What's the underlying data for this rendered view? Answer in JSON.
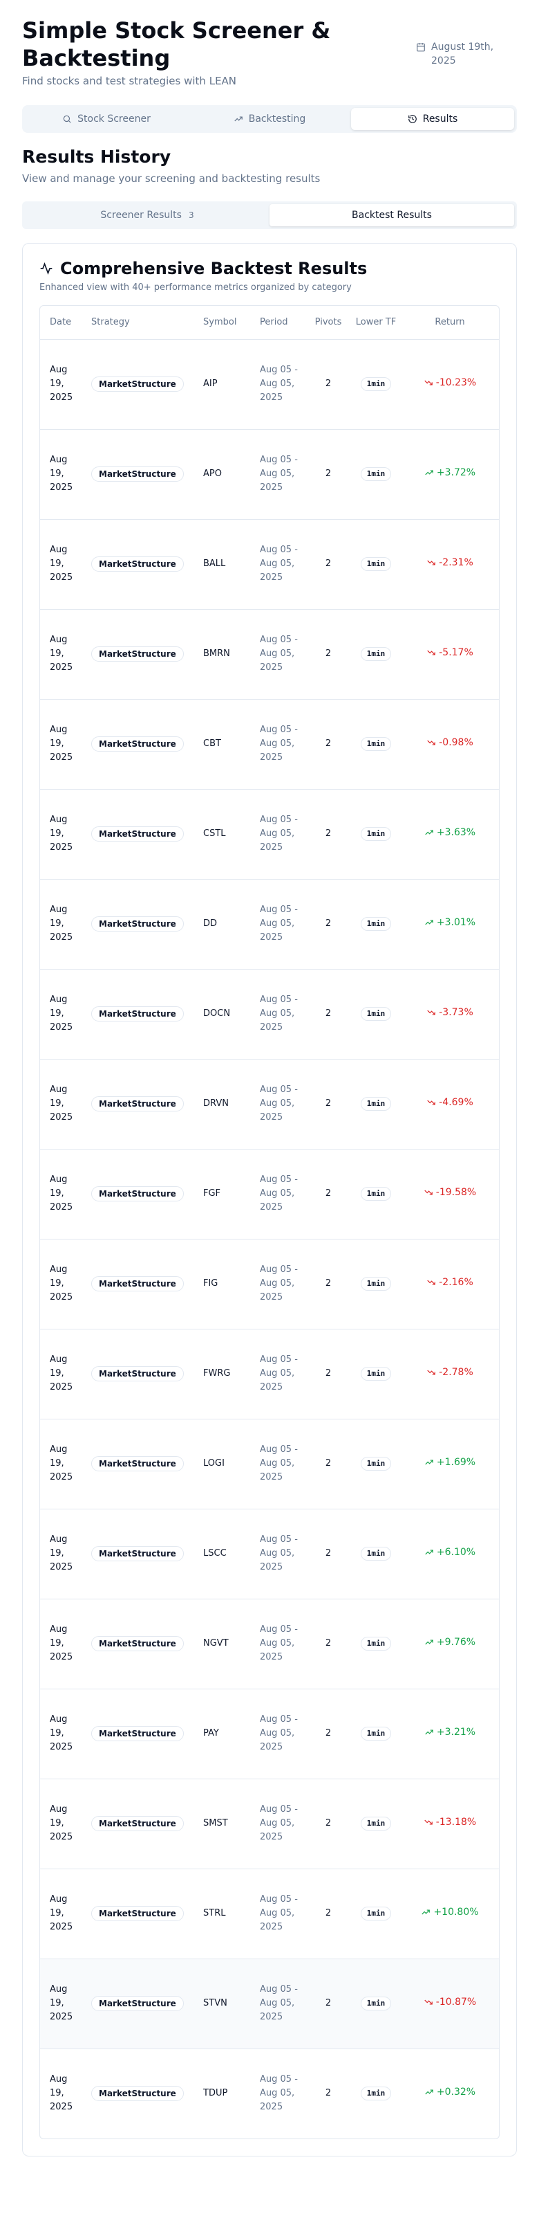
{
  "app": {
    "title": "Simple Stock Screener & Backtesting",
    "subtitle": "Find stocks and test strategies with LEAN",
    "date": "August 19th, 2025"
  },
  "main_tabs": [
    {
      "label": "Stock Screener",
      "icon": "search-icon",
      "active": false
    },
    {
      "label": "Backtesting",
      "icon": "trending-up-icon",
      "active": false
    },
    {
      "label": "Results",
      "icon": "history-icon",
      "active": true
    }
  ],
  "section": {
    "title": "Results History",
    "subtitle": "View and manage your screening and backtesting results"
  },
  "sub_tabs": [
    {
      "label": "Screener Results",
      "count": "3",
      "active": false
    },
    {
      "label": "Backtest Results",
      "count": "",
      "active": true
    }
  ],
  "card": {
    "title": "Comprehensive Backtest Results",
    "subtitle": "Enhanced view with 40+ performance metrics organized by category"
  },
  "table": {
    "headers": {
      "date": "Date",
      "strategy": "Strategy",
      "symbol": "Symbol",
      "period": "Period",
      "pivots": "Pivots",
      "lower_tf": "Lower TF",
      "return": "Return"
    },
    "rows": [
      {
        "date": "Aug 19, 2025",
        "strategy": "MarketStructure",
        "symbol": "AIP",
        "period": "Aug 05 - Aug 05, 2025",
        "pivots": "2",
        "tf": "1min",
        "ret": "-10.23%",
        "dir": "neg"
      },
      {
        "date": "Aug 19, 2025",
        "strategy": "MarketStructure",
        "symbol": "APO",
        "period": "Aug 05 - Aug 05, 2025",
        "pivots": "2",
        "tf": "1min",
        "ret": "+3.72%",
        "dir": "pos"
      },
      {
        "date": "Aug 19, 2025",
        "strategy": "MarketStructure",
        "symbol": "BALL",
        "period": "Aug 05 - Aug 05, 2025",
        "pivots": "2",
        "tf": "1min",
        "ret": "-2.31%",
        "dir": "neg"
      },
      {
        "date": "Aug 19, 2025",
        "strategy": "MarketStructure",
        "symbol": "BMRN",
        "period": "Aug 05 - Aug 05, 2025",
        "pivots": "2",
        "tf": "1min",
        "ret": "-5.17%",
        "dir": "neg"
      },
      {
        "date": "Aug 19, 2025",
        "strategy": "MarketStructure",
        "symbol": "CBT",
        "period": "Aug 05 - Aug 05, 2025",
        "pivots": "2",
        "tf": "1min",
        "ret": "-0.98%",
        "dir": "neg"
      },
      {
        "date": "Aug 19, 2025",
        "strategy": "MarketStructure",
        "symbol": "CSTL",
        "period": "Aug 05 - Aug 05, 2025",
        "pivots": "2",
        "tf": "1min",
        "ret": "+3.63%",
        "dir": "pos"
      },
      {
        "date": "Aug 19, 2025",
        "strategy": "MarketStructure",
        "symbol": "DD",
        "period": "Aug 05 - Aug 05, 2025",
        "pivots": "2",
        "tf": "1min",
        "ret": "+3.01%",
        "dir": "pos"
      },
      {
        "date": "Aug 19, 2025",
        "strategy": "MarketStructure",
        "symbol": "DOCN",
        "period": "Aug 05 - Aug 05, 2025",
        "pivots": "2",
        "tf": "1min",
        "ret": "-3.73%",
        "dir": "neg"
      },
      {
        "date": "Aug 19, 2025",
        "strategy": "MarketStructure",
        "symbol": "DRVN",
        "period": "Aug 05 - Aug 05, 2025",
        "pivots": "2",
        "tf": "1min",
        "ret": "-4.69%",
        "dir": "neg"
      },
      {
        "date": "Aug 19, 2025",
        "strategy": "MarketStructure",
        "symbol": "FGF",
        "period": "Aug 05 - Aug 05, 2025",
        "pivots": "2",
        "tf": "1min",
        "ret": "-19.58%",
        "dir": "neg"
      },
      {
        "date": "Aug 19, 2025",
        "strategy": "MarketStructure",
        "symbol": "FIG",
        "period": "Aug 05 - Aug 05, 2025",
        "pivots": "2",
        "tf": "1min",
        "ret": "-2.16%",
        "dir": "neg"
      },
      {
        "date": "Aug 19, 2025",
        "strategy": "MarketStructure",
        "symbol": "FWRG",
        "period": "Aug 05 - Aug 05, 2025",
        "pivots": "2",
        "tf": "1min",
        "ret": "-2.78%",
        "dir": "neg"
      },
      {
        "date": "Aug 19, 2025",
        "strategy": "MarketStructure",
        "symbol": "LOGI",
        "period": "Aug 05 - Aug 05, 2025",
        "pivots": "2",
        "tf": "1min",
        "ret": "+1.69%",
        "dir": "pos"
      },
      {
        "date": "Aug 19, 2025",
        "strategy": "MarketStructure",
        "symbol": "LSCC",
        "period": "Aug 05 - Aug 05, 2025",
        "pivots": "2",
        "tf": "1min",
        "ret": "+6.10%",
        "dir": "pos"
      },
      {
        "date": "Aug 19, 2025",
        "strategy": "MarketStructure",
        "symbol": "NGVT",
        "period": "Aug 05 - Aug 05, 2025",
        "pivots": "2",
        "tf": "1min",
        "ret": "+9.76%",
        "dir": "pos"
      },
      {
        "date": "Aug 19, 2025",
        "strategy": "MarketStructure",
        "symbol": "PAY",
        "period": "Aug 05 - Aug 05, 2025",
        "pivots": "2",
        "tf": "1min",
        "ret": "+3.21%",
        "dir": "pos"
      },
      {
        "date": "Aug 19, 2025",
        "strategy": "MarketStructure",
        "symbol": "SMST",
        "period": "Aug 05 - Aug 05, 2025",
        "pivots": "2",
        "tf": "1min",
        "ret": "-13.18%",
        "dir": "neg"
      },
      {
        "date": "Aug 19, 2025",
        "strategy": "MarketStructure",
        "symbol": "STRL",
        "period": "Aug 05 - Aug 05, 2025",
        "pivots": "2",
        "tf": "1min",
        "ret": "+10.80%",
        "dir": "pos"
      },
      {
        "date": "Aug 19, 2025",
        "strategy": "MarketStructure",
        "symbol": "STVN",
        "period": "Aug 05 - Aug 05, 2025",
        "pivots": "2",
        "tf": "1min",
        "ret": "-10.87%",
        "dir": "neg",
        "highlight": true
      },
      {
        "date": "Aug 19, 2025",
        "strategy": "MarketStructure",
        "symbol": "TDUP",
        "period": "Aug 05 - Aug 05, 2025",
        "pivots": "2",
        "tf": "1min",
        "ret": "+0.32%",
        "dir": "pos"
      }
    ]
  },
  "colors": {
    "positive": "#16a34a",
    "negative": "#dc2626",
    "muted": "#64748b"
  }
}
